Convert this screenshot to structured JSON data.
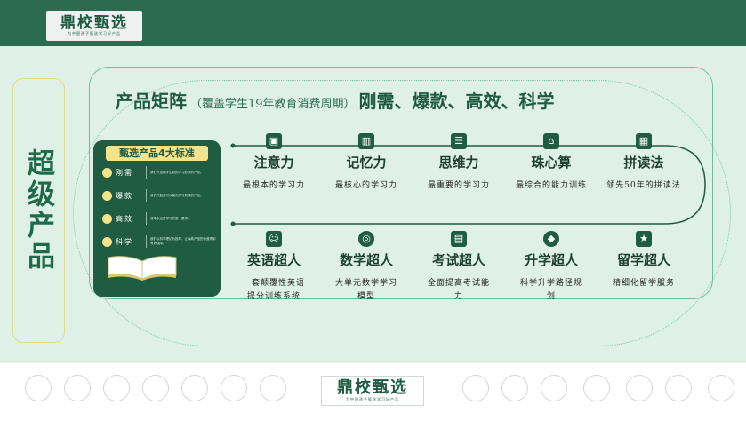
{
  "brand": {
    "name": "鼎校甄选",
    "slogan": "为中国孩子甄选学习好产品"
  },
  "side_title": "超级产品",
  "header": {
    "main": "产品矩阵",
    "sub": "（覆盖学生19年教育消费周期）",
    "tail": "刚需、爆款、高效、科学"
  },
  "standards": {
    "title": "甄选产品4大标准",
    "items": [
      {
        "label": "刚需",
        "desc": "我们只选择学生真的学习必须的产品。"
      },
      {
        "label": "爆款",
        "desc": "我们只甄选可以量化学习效果的产品。"
      },
      {
        "label": "高效",
        "desc": "效率永远是学习的第一要求。"
      },
      {
        "label": "科学",
        "desc": "我们以科学理论为指导，让每款产品的价值得到有效保障。"
      }
    ]
  },
  "top_row": [
    {
      "title": "注意力",
      "desc": "最根本的学习力",
      "icon": "chart-board-icon"
    },
    {
      "title": "记忆力",
      "desc": "最核心的学习力",
      "icon": "building-icon"
    },
    {
      "title": "思维力",
      "desc": "最重要的学习力",
      "icon": "list-window-icon"
    },
    {
      "title": "珠心算",
      "desc": "最综合的能力训练",
      "icon": "store-icon"
    },
    {
      "title": "拼读法",
      "desc": "领先50年的拼读法",
      "icon": "grid-icon"
    }
  ],
  "bottom_row": [
    {
      "title": "英语超人",
      "desc": "一套颠覆性英语\n提分训练系统",
      "icon": "contact-card-icon"
    },
    {
      "title": "数学超人",
      "desc": "大单元数学学习\n模型",
      "icon": "target-icon"
    },
    {
      "title": "考试超人",
      "desc": "全面提高考试能\n力",
      "icon": "briefcase-icon"
    },
    {
      "title": "升学超人",
      "desc": "科学升学路径规\n划",
      "icon": "tag-icon"
    },
    {
      "title": "留学超人",
      "desc": "精细化留学服务",
      "icon": "star-badge-icon"
    }
  ],
  "colors": {
    "primary": "#1f5c42",
    "topbar": "#2d6b50",
    "background": "#dff1e7",
    "accent": "#f5e38a"
  }
}
